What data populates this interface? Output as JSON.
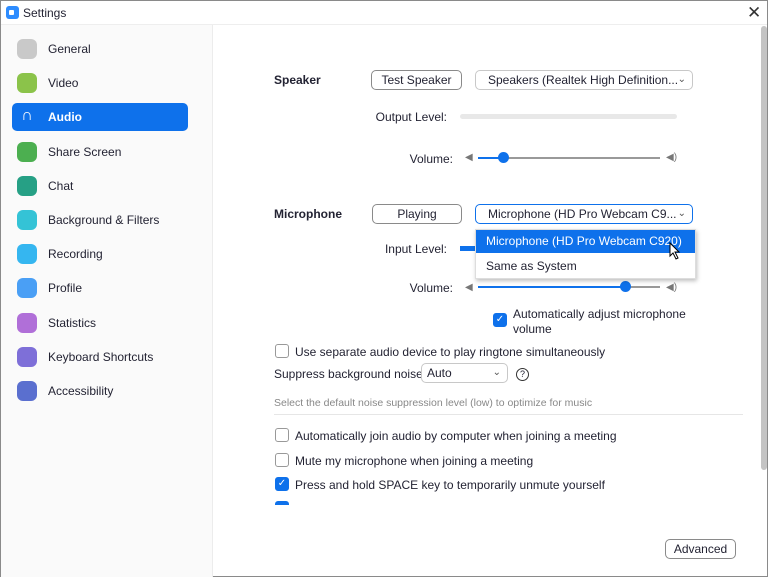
{
  "window": {
    "title": "Settings"
  },
  "sidebar": {
    "items": [
      {
        "label": "General",
        "icon": "gear-icon",
        "color": "#c9c9c9"
      },
      {
        "label": "Video",
        "icon": "video-icon",
        "color": "#8bc34a"
      },
      {
        "label": "Audio",
        "icon": "headphones-icon",
        "color": "#0e71eb",
        "active": true
      },
      {
        "label": "Share Screen",
        "icon": "share-screen-icon",
        "color": "#4caf50"
      },
      {
        "label": "Chat",
        "icon": "chat-icon",
        "color": "#26a085"
      },
      {
        "label": "Background & Filters",
        "icon": "background-icon",
        "color": "#34c3d6"
      },
      {
        "label": "Recording",
        "icon": "recording-icon",
        "color": "#35b6f0"
      },
      {
        "label": "Profile",
        "icon": "profile-icon",
        "color": "#4a9ff5"
      },
      {
        "label": "Statistics",
        "icon": "statistics-icon",
        "color": "#b06fd8"
      },
      {
        "label": "Keyboard Shortcuts",
        "icon": "keyboard-icon",
        "color": "#7e6fd8"
      },
      {
        "label": "Accessibility",
        "icon": "accessibility-icon",
        "color": "#5a6fcf"
      }
    ]
  },
  "speaker": {
    "label": "Speaker",
    "test_button": "Test Speaker",
    "device": "Speakers (Realtek High Definition...",
    "output_level_label": "Output Level:",
    "volume_label": "Volume:",
    "volume": 0.14
  },
  "microphone": {
    "label": "Microphone",
    "test_button": "Playing",
    "device": "Microphone (HD Pro Webcam C9...",
    "input_level_label": "Input Level:",
    "volume_label": "Volume:",
    "volume": 0.81,
    "dropdown_options": [
      "Microphone (HD Pro Webcam C920)",
      "Same as System"
    ],
    "auto_adjust_label": "Automatically adjust microphone volume",
    "auto_adjust": true
  },
  "separate_device": {
    "label": "Use separate audio device to play ringtone simultaneously",
    "checked": false
  },
  "suppress": {
    "label": "Suppress background noise",
    "value": "Auto",
    "hint": "Select the default noise suppression level (low) to optimize for music"
  },
  "options": [
    {
      "label": "Automatically join audio by computer when joining a meeting",
      "checked": false
    },
    {
      "label": "Mute my microphone when joining a meeting",
      "checked": false
    },
    {
      "label": "Press and hold SPACE key to temporarily unmute yourself",
      "checked": true
    }
  ],
  "advanced_button": "Advanced"
}
